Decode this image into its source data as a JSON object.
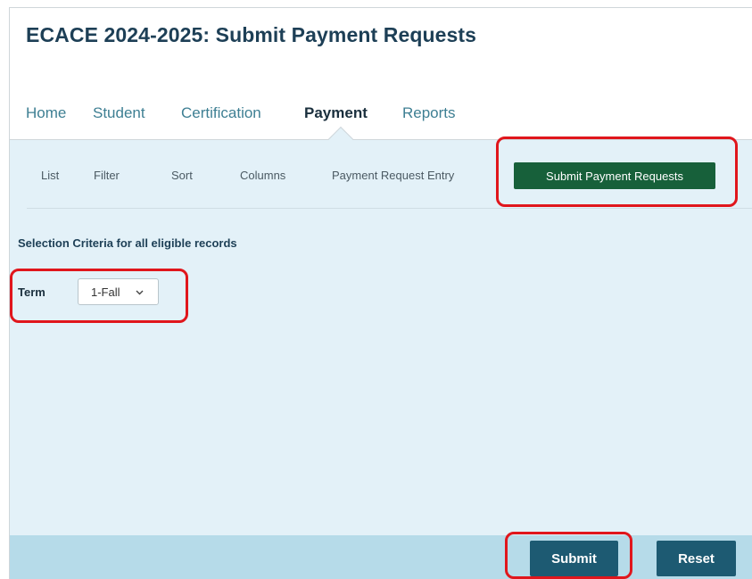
{
  "page": {
    "title": "ECACE 2024-2025: Submit Payment Requests"
  },
  "nav": {
    "items": [
      "Home",
      "Student",
      "Certification",
      "Payment",
      "Reports"
    ],
    "active": "Payment"
  },
  "subnav": {
    "items": [
      "List",
      "Filter",
      "Sort",
      "Columns",
      "Payment Request Entry"
    ],
    "active_label": "Submit Payment Requests"
  },
  "criteria": {
    "title": "Selection Criteria for all eligible records",
    "term_label": "Term",
    "term_value": "1-Fall",
    "term_options": [
      "1-Fall"
    ]
  },
  "footer": {
    "submit_label": "Submit",
    "reset_label": "Reset"
  },
  "colors": {
    "active_button": "#17603a",
    "action_button": "#1d5a72",
    "panel_bg": "#e3f1f8",
    "footer_bg": "#b6dbe9",
    "highlight": "#e0161c"
  },
  "icons": {
    "term_dropdown": "chevron-down-icon"
  }
}
